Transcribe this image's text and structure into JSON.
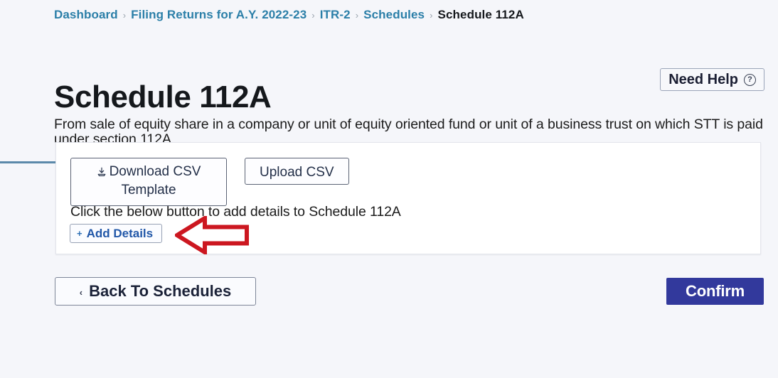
{
  "breadcrumb": {
    "separator": "›",
    "items": [
      {
        "label": "Dashboard",
        "current": false
      },
      {
        "label": "Filing Returns for A.Y. 2022-23",
        "current": false
      },
      {
        "label": "ITR-2",
        "current": false
      },
      {
        "label": "Schedules",
        "current": false
      },
      {
        "label": "Schedule 112A",
        "current": true
      }
    ]
  },
  "header": {
    "title": "Schedule 112A",
    "description": "From sale of equity share in a company or unit of equity oriented fund or unit of a business trust on which STT is paid under section 112A",
    "need_help_label": "Need Help",
    "need_help_icon": "question-circle-icon",
    "need_help_glyph": "?"
  },
  "card": {
    "download_csv_label": "Download CSV Template",
    "download_icon": "download-icon",
    "upload_csv_label": "Upload CSV",
    "hint": "Click the below button to add details to Schedule 112A",
    "add_details_label": "Add Details",
    "add_details_icon": "plus-icon",
    "add_details_glyph": "+"
  },
  "annotation": {
    "arrow_icon": "red-left-arrow-annotation",
    "color": "#cc1720"
  },
  "footer": {
    "back_label": "Back To Schedules",
    "back_chevron": "‹",
    "confirm_label": "Confirm"
  },
  "colors": {
    "page_background": "#f5f6fa",
    "breadcrumb_link": "#2b7fa8",
    "breadcrumb_current": "#15181c",
    "accent_rule": "#5b89aa",
    "confirm_background": "#32399c",
    "add_details_text": "#2157a8",
    "annotation_red": "#cc1720"
  }
}
